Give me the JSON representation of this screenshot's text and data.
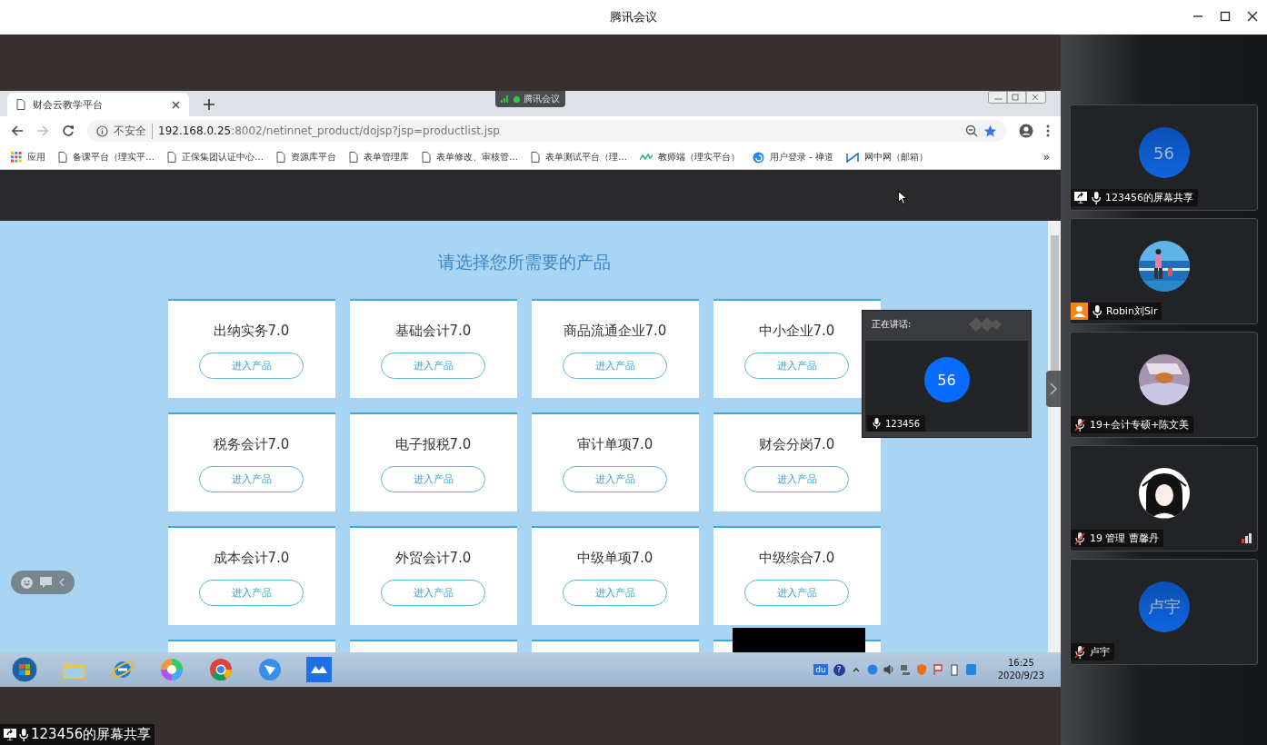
{
  "app": {
    "title": "腾讯会议"
  },
  "shared_screen": {
    "meeting_pill": {
      "label": "腾讯会议"
    },
    "browser": {
      "tab": {
        "title": "财会云教学平台"
      },
      "address": {
        "security": "不安全",
        "host": "192.168.0.25",
        "path": ":8002/netinnet_product/dojsp?jsp=productlist.jsp"
      },
      "bookmarks": [
        {
          "kind": "apps",
          "label": "应用"
        },
        {
          "kind": "page",
          "label": "备课平台（理实平…"
        },
        {
          "kind": "page",
          "label": "正保集团认证中心…"
        },
        {
          "kind": "page",
          "label": "资源库平台"
        },
        {
          "kind": "page",
          "label": "表单管理库"
        },
        {
          "kind": "page",
          "label": "表单修改、审核管…"
        },
        {
          "kind": "page",
          "label": "表单测试平台（理…"
        },
        {
          "kind": "chart",
          "label": "教师端（理实平台）"
        },
        {
          "kind": "swirl",
          "label": "用户登录 - 禅道"
        },
        {
          "kind": "mesh",
          "label": "网中网（邮箱）"
        }
      ],
      "more": "»",
      "page": {
        "heading": "请选择您所需要的产品",
        "products": [
          {
            "name": "出纳实务7.0",
            "button": "进入产品"
          },
          {
            "name": "基础会计7.0",
            "button": "进入产品"
          },
          {
            "name": "商品流通企业7.0",
            "button": "进入产品"
          },
          {
            "name": "中小企业7.0",
            "button": "进入产品"
          },
          {
            "name": "税务会计7.0",
            "button": "进入产品"
          },
          {
            "name": "电子报税7.0",
            "button": "进入产品"
          },
          {
            "name": "审计单项7.0",
            "button": "进入产品"
          },
          {
            "name": "财会分岗7.0",
            "button": "进入产品"
          },
          {
            "name": "成本会计7.0",
            "button": "进入产品"
          },
          {
            "name": "外贸会计7.0",
            "button": "进入产品"
          },
          {
            "name": "中级单项7.0",
            "button": "进入产品"
          },
          {
            "name": "中级综合7.0",
            "button": "进入产品"
          },
          {
            "redacted": false
          },
          {
            "redacted": false
          },
          {
            "redacted": false
          },
          {
            "redacted": true
          }
        ]
      }
    },
    "speaking": {
      "label": "正在讲话:",
      "avatar": "56",
      "name": "123456"
    },
    "taskbar": {
      "apps": [
        {
          "kind": "start"
        },
        {
          "kind": "folder"
        },
        {
          "kind": "ie"
        },
        {
          "kind": "wheel"
        },
        {
          "kind": "chrome"
        },
        {
          "kind": "bird"
        },
        {
          "kind": "meeting"
        }
      ],
      "tray": [
        {
          "kind": "baidu",
          "label": "du"
        },
        {
          "kind": "help",
          "label": "?"
        },
        {
          "kind": "caret"
        },
        {
          "kind": "bluedot"
        },
        {
          "kind": "volume"
        },
        {
          "kind": "network"
        },
        {
          "kind": "shield"
        },
        {
          "kind": "flag"
        },
        {
          "kind": "battery"
        },
        {
          "kind": "sync"
        }
      ],
      "time": "16:25",
      "date": "2020/9/23"
    },
    "share_label": "123456的屏幕共享"
  },
  "participants": [
    {
      "name": "123456的屏幕共享",
      "avatar": {
        "kind": "initials",
        "text": "56"
      },
      "sharing": true,
      "host": false,
      "muted": false,
      "signal": false
    },
    {
      "name": "Robin刘Sir",
      "sharing": false,
      "host": true,
      "muted": false,
      "signal": false
    },
    {
      "name": "19+会计专硕+陈文美",
      "sharing": false,
      "host": false,
      "muted": true,
      "signal": false
    },
    {
      "name": "19 管理 曹馨丹",
      "sharing": false,
      "host": false,
      "muted": true,
      "signal": true
    },
    {
      "name": "卢宇",
      "avatar": {
        "kind": "initials",
        "text": "卢宇"
      },
      "sharing": false,
      "host": false,
      "muted": true,
      "signal": false
    }
  ]
}
